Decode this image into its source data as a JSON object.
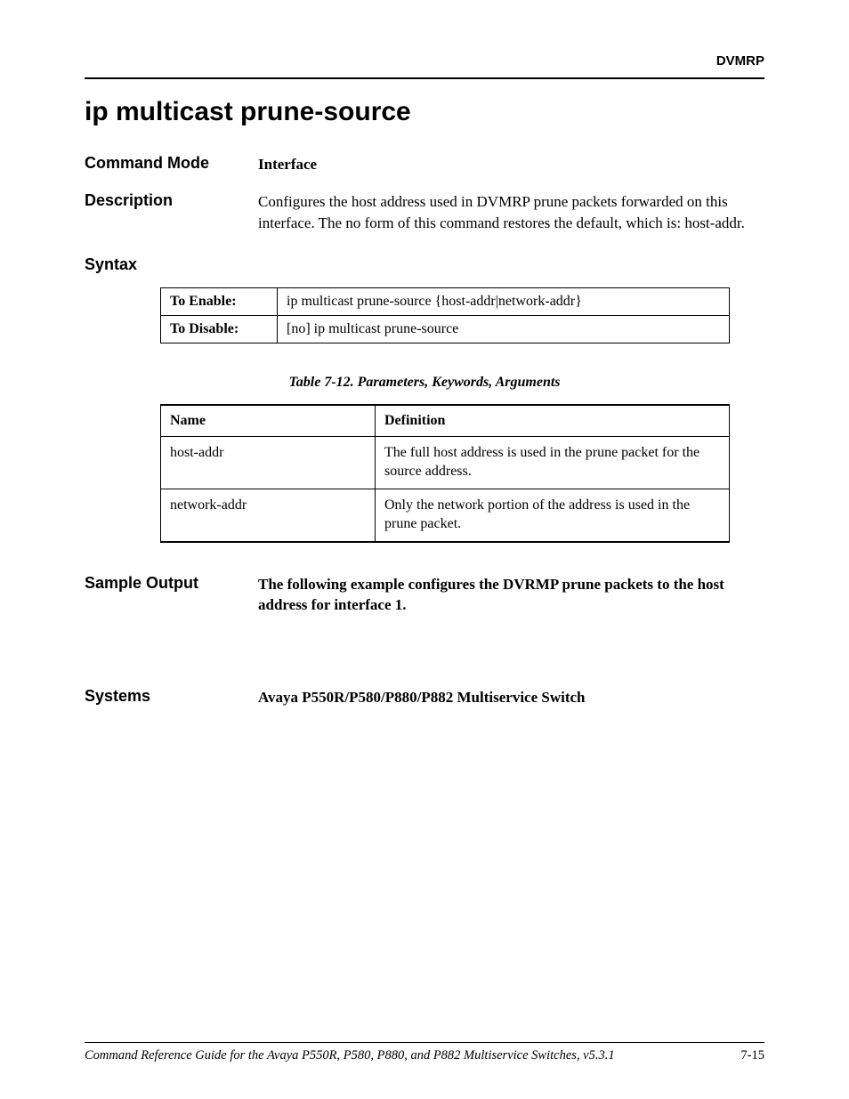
{
  "header": {
    "label": "DVMRP"
  },
  "title": "ip multicast prune-source",
  "command_mode": {
    "label": "Command Mode",
    "value": "Interface"
  },
  "description": {
    "label": "Description",
    "text": "Configures the host address used in DVMRP prune packets forwarded on this interface. The no form of this command restores the default, which is: host-addr."
  },
  "syntax": {
    "label": "Syntax",
    "rows": [
      {
        "label": "To Enable:",
        "value": "ip multicast prune-source {host-addr|network-addr}"
      },
      {
        "label": "To Disable:",
        "value": "[no] ip multicast prune-source"
      }
    ]
  },
  "params_table": {
    "caption": "Table 7-12.  Parameters, Keywords, Arguments",
    "headers": [
      "Name",
      "Definition"
    ],
    "rows": [
      {
        "name": "host-addr",
        "definition": "The full host address is used in the prune packet for the source address."
      },
      {
        "name": "network-addr",
        "definition": "Only the network portion of the address is used in the prune packet."
      }
    ]
  },
  "sample_output": {
    "label": "Sample Output",
    "text": "The following example configures the DVRMP prune packets to the host address for interface 1."
  },
  "systems": {
    "label": "Systems",
    "text": "Avaya P550R/P580/P880/P882 Multiservice Switch"
  },
  "footer": {
    "text": "Command Reference Guide for the Avaya P550R, P580, P880, and P882 Multiservice Switches, v5.3.1",
    "page": "7-15"
  }
}
